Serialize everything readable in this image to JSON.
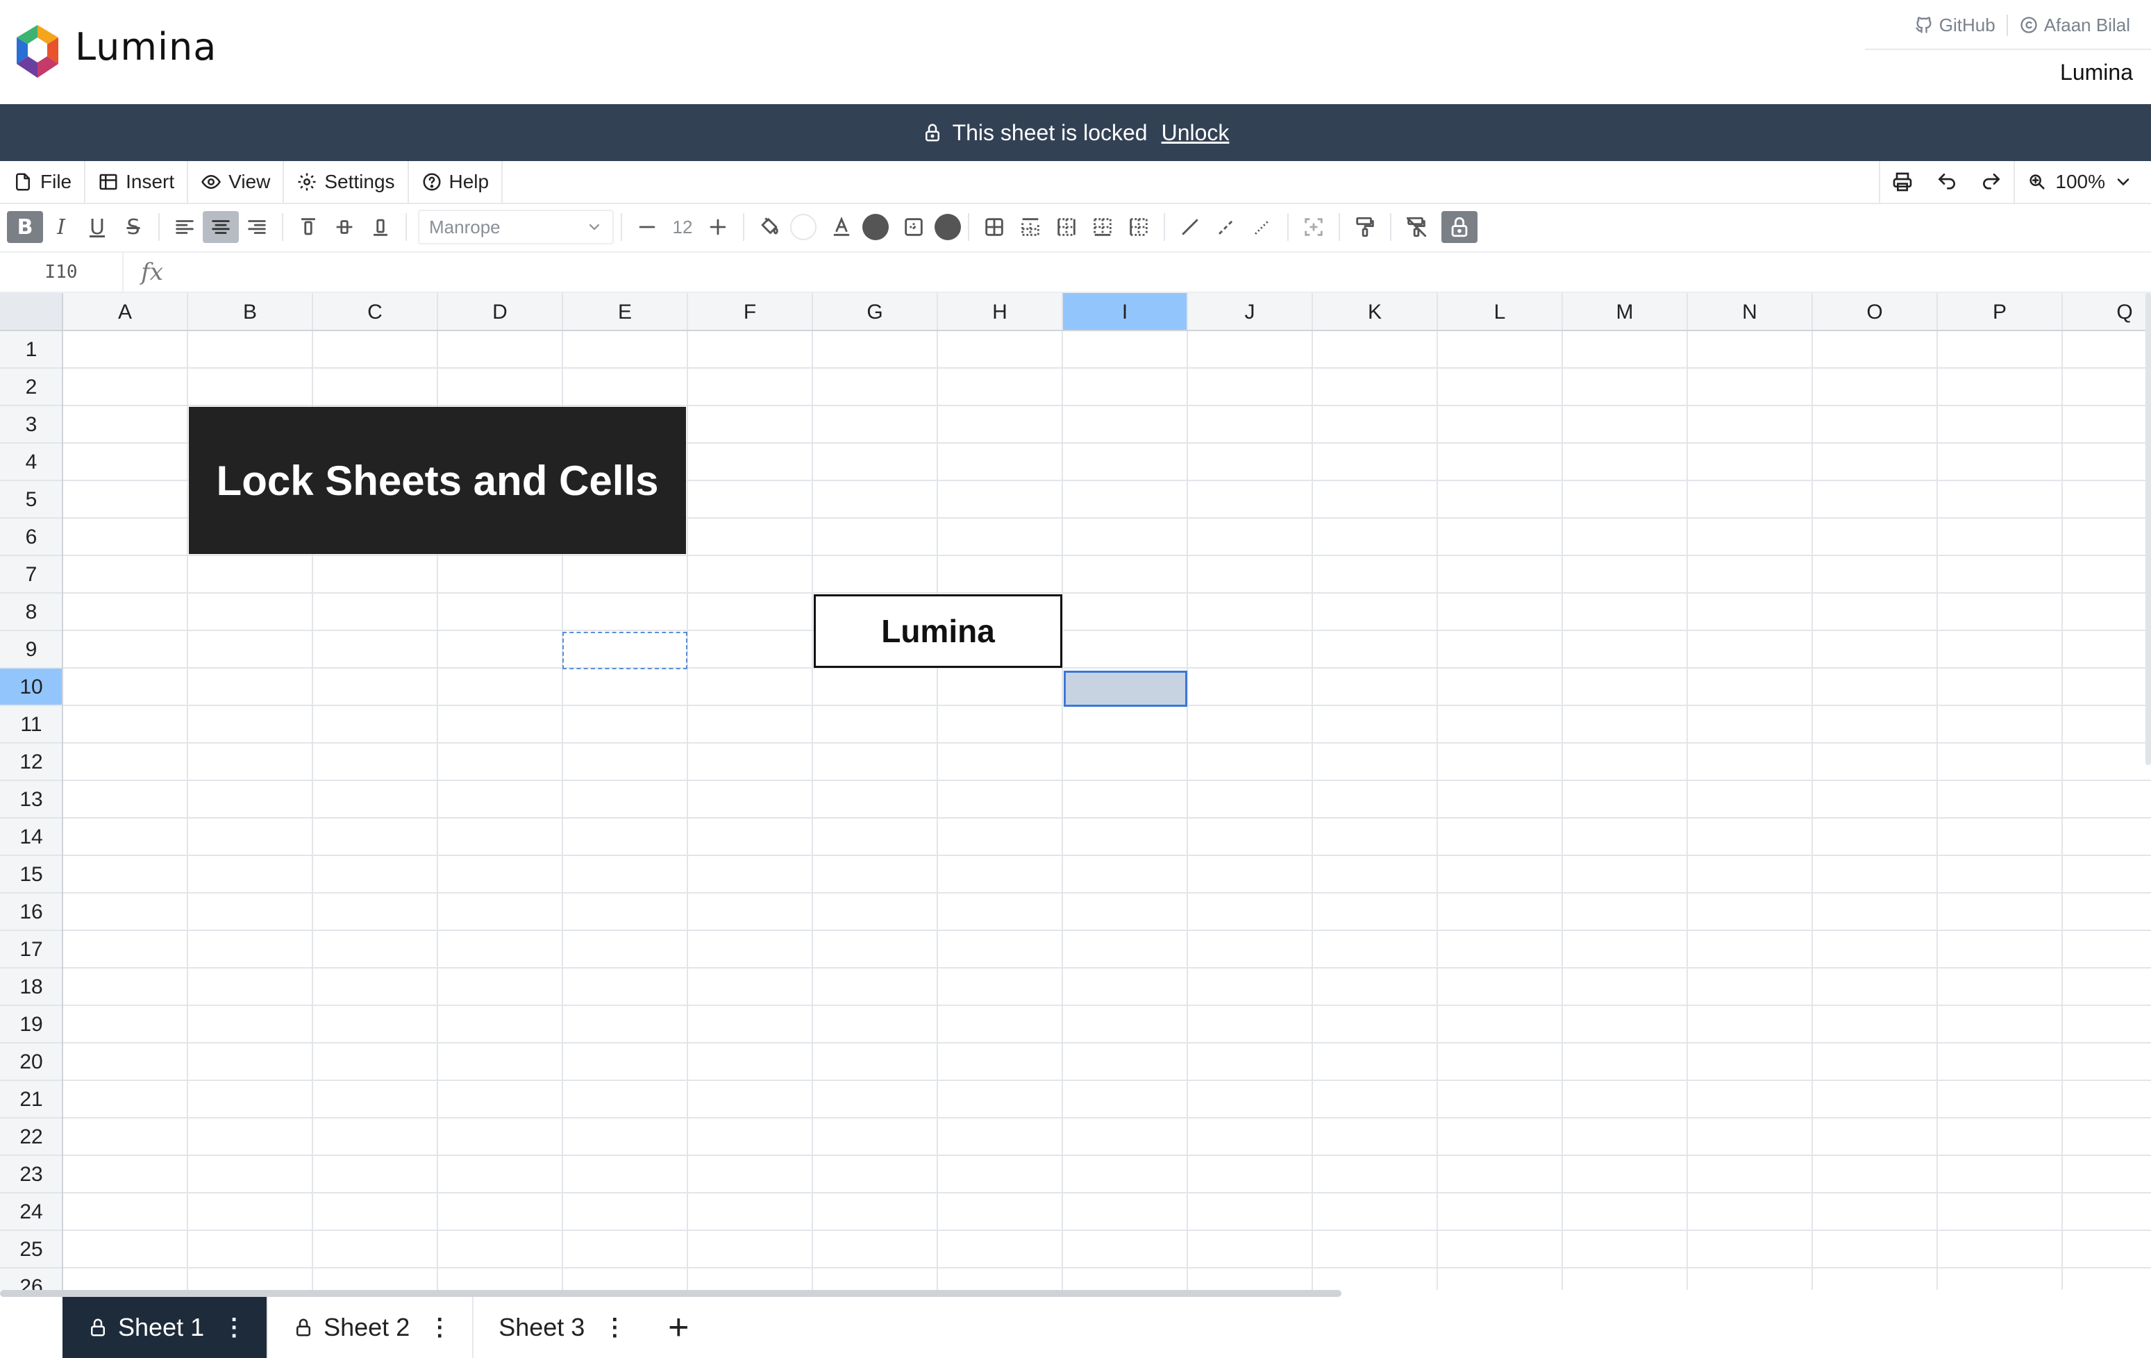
{
  "app": {
    "title": "Lumina",
    "brand_right": "Lumina",
    "links": [
      {
        "label": "GitHub",
        "icon": "github-icon"
      },
      {
        "label": "Afaan Bilal",
        "icon": "copyright-icon"
      }
    ]
  },
  "banner": {
    "text": "This sheet is locked",
    "unlock_label": "Unlock",
    "icon": "lock-icon",
    "background": "#334155"
  },
  "menu": {
    "items": [
      {
        "label": "File",
        "icon": "file-icon"
      },
      {
        "label": "Insert",
        "icon": "table-icon"
      },
      {
        "label": "View",
        "icon": "eye-icon"
      },
      {
        "label": "Settings",
        "icon": "gear-icon"
      },
      {
        "label": "Help",
        "icon": "help-icon"
      }
    ],
    "zoom": "100%"
  },
  "toolbar": {
    "font_family": "Manrope",
    "font_size": "12",
    "bold_label": "B",
    "italic_label": "I",
    "underline_label": "U",
    "strike_label": "S",
    "active_align": "center"
  },
  "formula": {
    "cell_ref": "I10",
    "fx_label": "fx",
    "value": ""
  },
  "grid": {
    "columns": [
      "A",
      "B",
      "C",
      "D",
      "E",
      "F",
      "G",
      "H",
      "I",
      "J",
      "K",
      "L",
      "M",
      "N",
      "O",
      "P",
      "Q"
    ],
    "rows": [
      "1",
      "2",
      "3",
      "4",
      "5",
      "6",
      "7",
      "8",
      "9",
      "10",
      "11",
      "12",
      "13",
      "14",
      "15",
      "16",
      "17",
      "18",
      "19",
      "20",
      "21",
      "22",
      "23",
      "24",
      "25",
      "26"
    ],
    "selected_column": "I",
    "selected_row": "10",
    "merged_cells": [
      {
        "range": "B3:E6",
        "text": "Lock Sheets and Cells",
        "background": "#222222",
        "color": "#ffffff"
      },
      {
        "range": "G8:H9",
        "text": "Lumina",
        "background": "#ffffff",
        "color": "#111111"
      }
    ],
    "copy_range": "E9",
    "accent": "#3b78d8",
    "header_highlight": "#93c5fd"
  },
  "sheets": [
    {
      "name": "Sheet 1",
      "locked": true,
      "active": true
    },
    {
      "name": "Sheet 2",
      "locked": true,
      "active": false
    },
    {
      "name": "Sheet 3",
      "locked": false,
      "active": false
    }
  ],
  "add_sheet_label": "+"
}
